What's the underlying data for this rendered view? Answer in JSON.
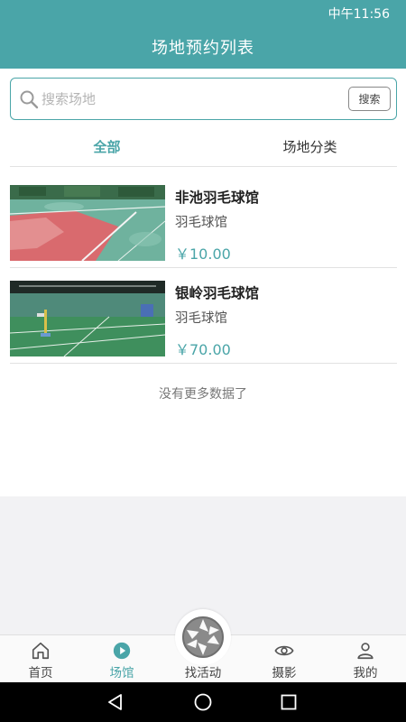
{
  "status_bar": {
    "time": "中午11:56"
  },
  "header": {
    "title": "场地预约列表"
  },
  "search": {
    "placeholder": "搜索场地",
    "button_label": "搜索"
  },
  "tabs": [
    {
      "label": "全部",
      "active": true
    },
    {
      "label": "场地分类",
      "active": false
    }
  ],
  "venues": [
    {
      "name": "非池羽毛球馆",
      "type": "羽毛球馆",
      "price": "￥10.00"
    },
    {
      "name": "银岭羽毛球馆",
      "type": "羽毛球馆",
      "price": "￥70.00"
    }
  ],
  "list_footer": "没有更多数据了",
  "bottom_tabs": [
    {
      "label": "首页",
      "icon": "home-icon",
      "active": false
    },
    {
      "label": "场馆",
      "icon": "play-circle-icon",
      "active": true
    },
    {
      "label": "找活动",
      "icon": "aperture-icon",
      "active": false
    },
    {
      "label": "摄影",
      "icon": "eye-icon",
      "active": false
    },
    {
      "label": "我的",
      "icon": "user-icon",
      "active": false
    }
  ],
  "colors": {
    "primary": "#4aa5a8",
    "page_background": "#f2f2f4"
  }
}
